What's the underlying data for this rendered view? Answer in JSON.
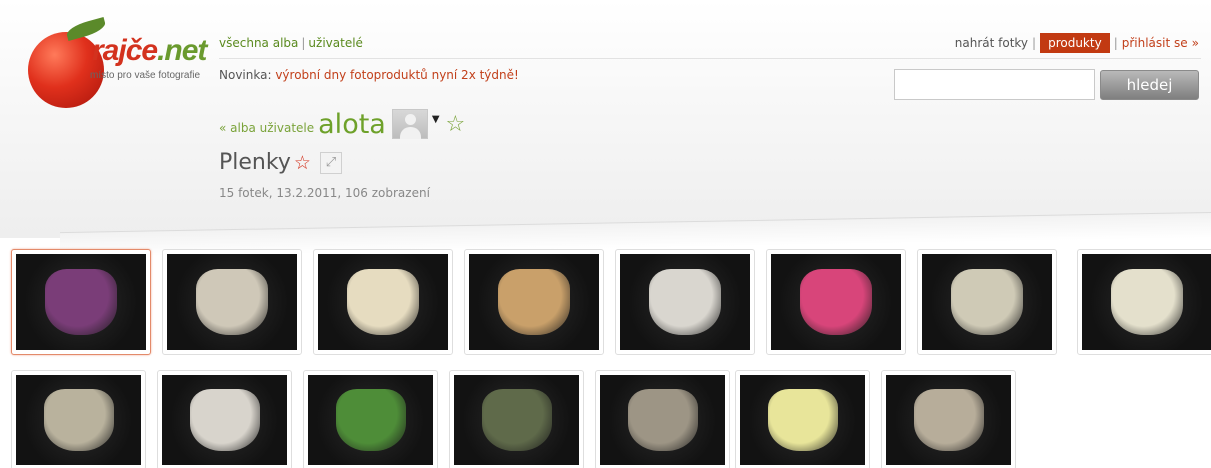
{
  "logo": {
    "brand": "rajče",
    "brand_dot": ".",
    "brand_tld": "net",
    "tagline": "místo pro vaše fotografie"
  },
  "top_links": {
    "all_albums": "všechna alba",
    "separator": "|",
    "users": "uživatelé"
  },
  "news": {
    "label": "Novinka:",
    "text": "výrobní dny fotoproduktů nyní 2x týdně!"
  },
  "right_links": {
    "upload": "nahrát fotky",
    "separator": "|",
    "products": "produkty",
    "login": "přihlásit se",
    "raquo": "»"
  },
  "search": {
    "value": "",
    "button": "hledej"
  },
  "user_row": {
    "back_link": "« alba uživatele",
    "user_name": "alota",
    "menu_arrow": "▼",
    "star": "☆"
  },
  "album": {
    "title": "Plenky",
    "star": "☆",
    "fullscreen": "⤢",
    "meta": "15 fotek, 13.2.2011, 106 zobrazení"
  },
  "colors": {
    "brand_red": "#d3321e",
    "brand_green": "#6ea12a",
    "products_bg": "#c23a12"
  },
  "thumbnails": [
    {
      "item_color": "#7a3d78",
      "selected": true
    },
    {
      "item_color": "#cfc8b8"
    },
    {
      "item_color": "#e6dcc0"
    },
    {
      "item_color": "#c9a06a"
    },
    {
      "item_color": "#d9d6cf"
    },
    {
      "item_color": "#d8457a"
    },
    {
      "item_color": "#cfcab6"
    },
    {
      "item_color": "#e4e0cc"
    },
    {
      "item_color": "#b9b29d"
    },
    {
      "item_color": "#d8d4cc"
    },
    {
      "item_color": "#4e8d38"
    },
    {
      "item_color": "#5f6a4a"
    },
    {
      "item_color": "#9d9585"
    },
    {
      "item_color": "#e8e59a"
    },
    {
      "item_color": "#b7ad9a"
    }
  ]
}
